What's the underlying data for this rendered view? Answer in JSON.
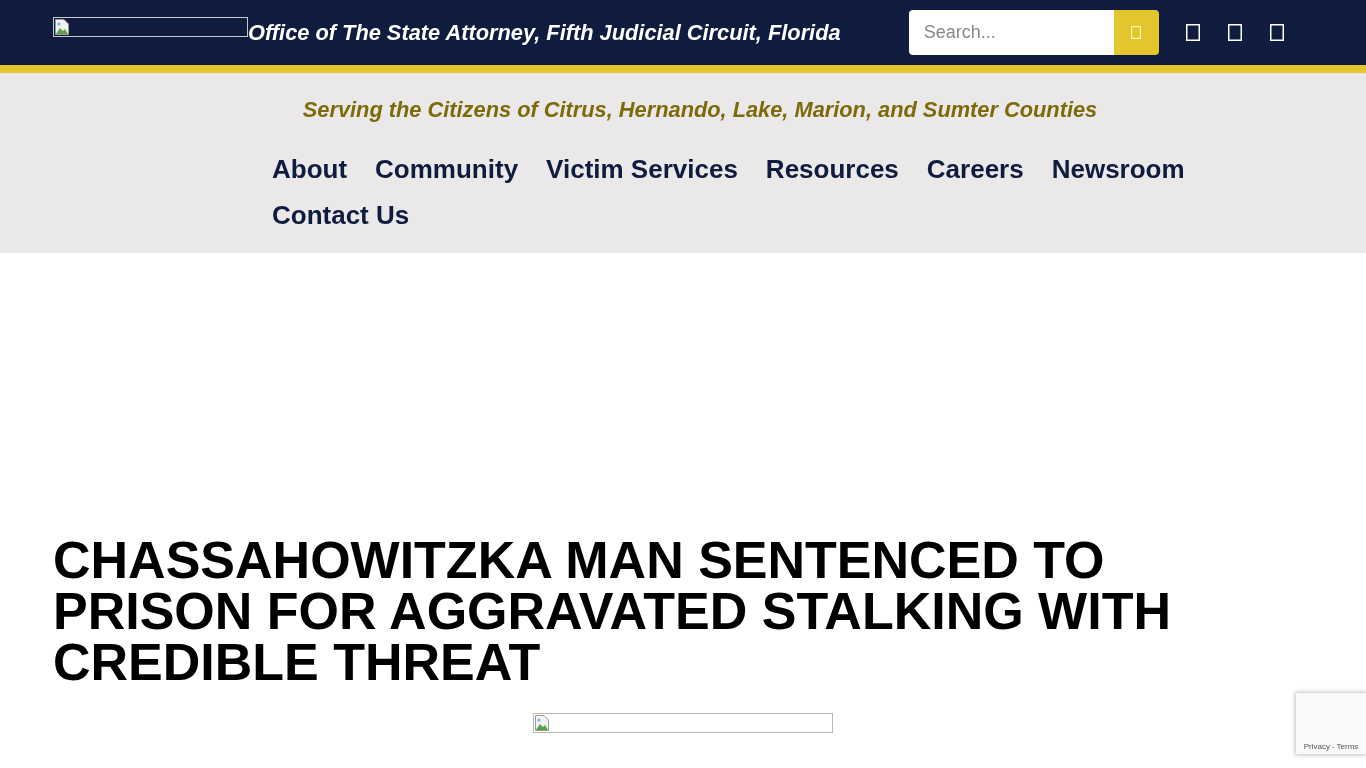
{
  "header": {
    "title": "Office of The State Attorney, Fifth Judicial Circuit, Florida",
    "search": {
      "placeholder": "Search..."
    }
  },
  "tagline": "Serving the Citizens of Citrus, Hernando, Lake, Marion, and Sumter Counties",
  "nav": [
    {
      "label": "About"
    },
    {
      "label": "Community"
    },
    {
      "label": "Victim Services"
    },
    {
      "label": "Resources"
    },
    {
      "label": "Careers"
    },
    {
      "label": "Newsroom"
    },
    {
      "label": "Contact Us"
    }
  ],
  "article": {
    "headline": "CHASSAHOWITZKA MAN SENTENCED TO PRISON FOR AGGRAVATED STALKING WITH CREDIBLE THREAT"
  },
  "recaptcha": {
    "links": [
      "Privacy",
      "Terms"
    ],
    "separator": "-"
  }
}
